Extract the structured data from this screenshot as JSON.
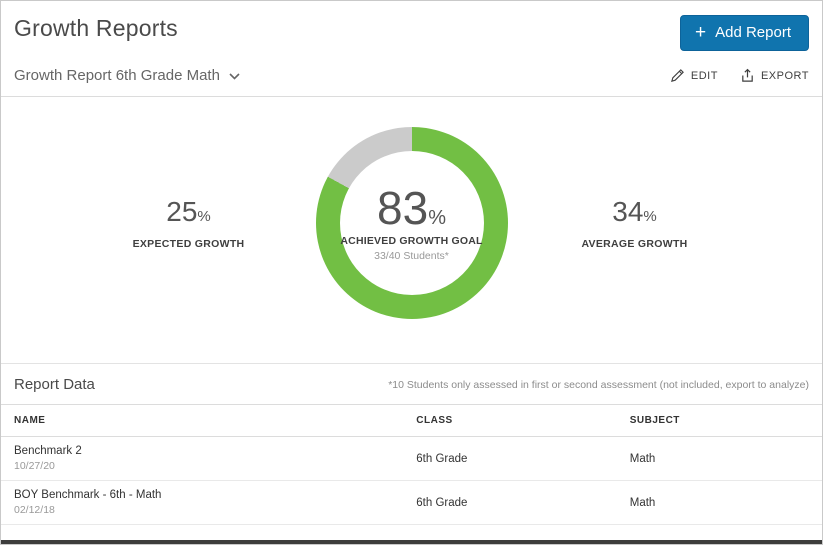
{
  "page": {
    "title": "Growth Reports"
  },
  "header": {
    "add_report": {
      "label": "Add Report",
      "plus": "+"
    }
  },
  "toolbar": {
    "report_selector": "Growth Report 6th Grade Math",
    "edit_label": "EDIT",
    "export_label": "EXPORT"
  },
  "chart_data": {
    "type": "donut",
    "title": "Achieved Growth Goal",
    "series": [
      {
        "name": "Achieved Growth Goal",
        "value": 83
      },
      {
        "name": "Remainder",
        "value": 17
      }
    ],
    "colors": {
      "achieved": "#72bf44",
      "remainder": "#cbcbcb"
    },
    "center": {
      "value": "83",
      "unit": "%",
      "label": "ACHIEVED GROWTH GOAL",
      "sublabel": "33/40 Students*"
    },
    "stats": {
      "left": {
        "value": "25",
        "unit": "%",
        "label": "EXPECTED GROWTH"
      },
      "right": {
        "value": "34",
        "unit": "%",
        "label": "AVERAGE GROWTH"
      }
    }
  },
  "report_data": {
    "section_title": "Report Data",
    "note": "*10 Students only assessed in first or second assessment (not included, export to analyze)",
    "columns": [
      "NAME",
      "CLASS",
      "SUBJECT"
    ],
    "rows": [
      {
        "name": "Benchmark 2",
        "date": "10/27/20",
        "class": "6th Grade",
        "subject": "Math"
      },
      {
        "name": "BOY Benchmark - 6th - Math",
        "date": "02/12/18",
        "class": "6th Grade",
        "subject": "Math"
      }
    ]
  }
}
